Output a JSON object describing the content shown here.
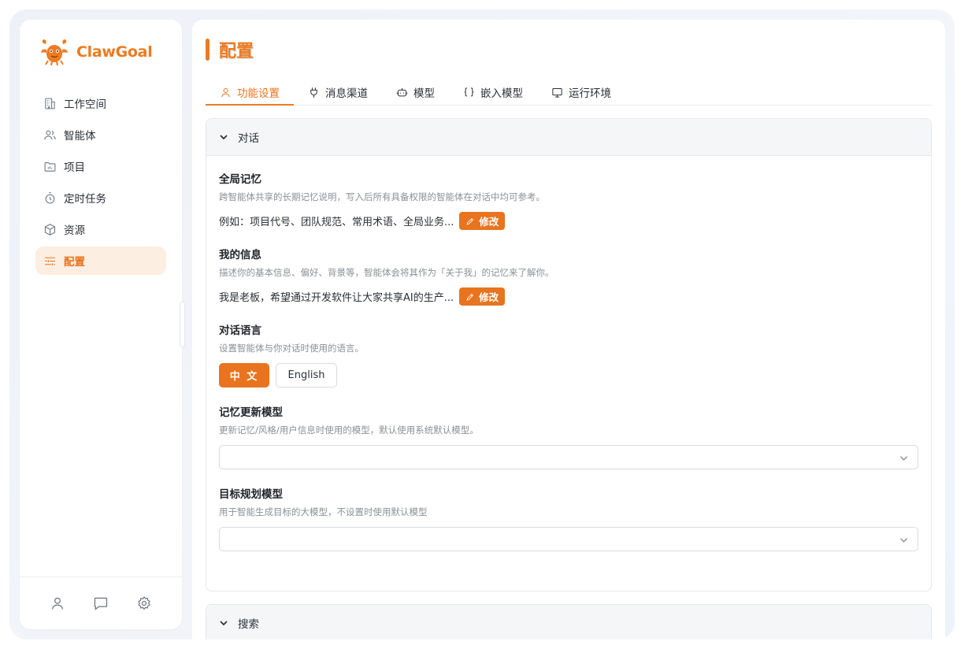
{
  "app": {
    "name": "ClawGoal",
    "brand_color": "#ec7b22"
  },
  "sidebar": {
    "items": [
      {
        "label": "工作空间",
        "icon": "building-icon"
      },
      {
        "label": "智能体",
        "icon": "users-icon"
      },
      {
        "label": "项目",
        "icon": "folder-icon"
      },
      {
        "label": "定时任务",
        "icon": "timer-icon"
      },
      {
        "label": "资源",
        "icon": "cube-icon"
      },
      {
        "label": "配置",
        "icon": "sliders-icon",
        "active": true
      }
    ],
    "footer": [
      "user-icon",
      "chat-icon",
      "gear-icon"
    ]
  },
  "page": {
    "title": "配置",
    "tabs": [
      {
        "label": "功能设置",
        "icon": "user-icon",
        "active": true
      },
      {
        "label": "消息渠道",
        "icon": "plug-icon"
      },
      {
        "label": "模型",
        "icon": "bot-icon"
      },
      {
        "label": "嵌入模型",
        "icon": "braces-icon"
      },
      {
        "label": "运行环境",
        "icon": "monitor-icon"
      }
    ]
  },
  "dialog_section": {
    "title": "对话",
    "global_memory": {
      "label": "全局记忆",
      "desc": "跨智能体共享的长期记忆说明，写入后所有具备权限的智能体在对话中均可参考。",
      "value": "例如：项目代号、团队规范、常用术语、全局业务...",
      "edit_label": "修改"
    },
    "my_info": {
      "label": "我的信息",
      "desc": "描述你的基本信息、偏好、背景等，智能体会将其作为「关于我」的记忆来了解你。",
      "value": "我是老板，希望通过开发软件让大家共享AI的生产...",
      "edit_label": "修改"
    },
    "language": {
      "label": "对话语言",
      "desc": "设置智能体与你对话时使用的语言。",
      "options": [
        "中 文",
        "English"
      ],
      "selected": "中 文"
    },
    "memory_model": {
      "label": "记忆更新模型",
      "desc": "更新记忆/风格/用户信息时使用的模型，默认使用系统默认模型。",
      "value": ""
    },
    "goal_model": {
      "label": "目标规划模型",
      "desc": "用于智能生成目标的大模型，不设置时使用默认模型",
      "value": ""
    }
  },
  "search_section": {
    "title": "搜索"
  }
}
